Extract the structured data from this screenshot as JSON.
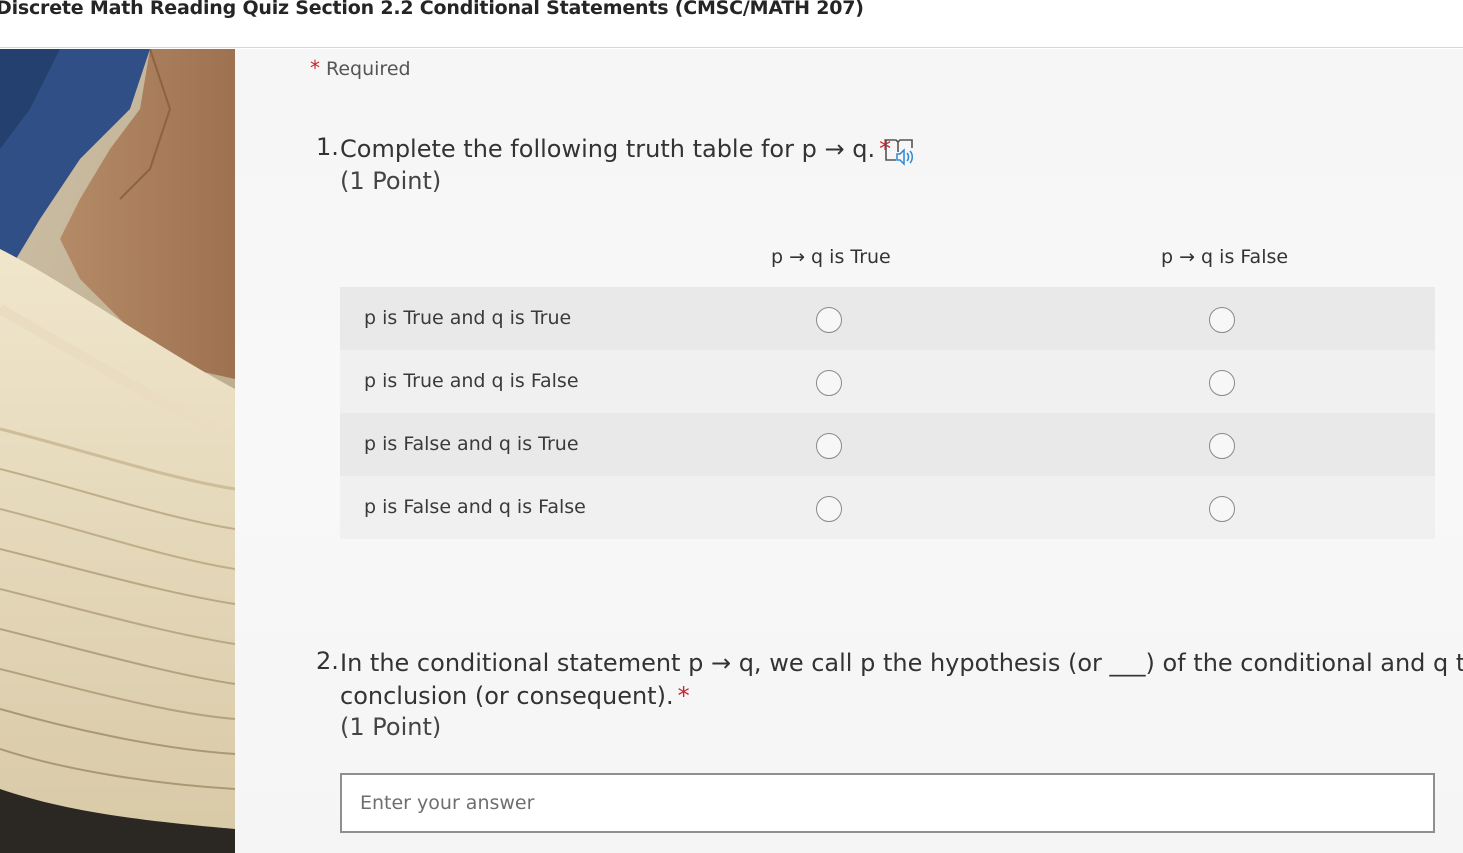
{
  "header": {
    "title": "Discrete Math Reading Quiz Section 2.2 Conditional Statements (CMSC/MATH 207)"
  },
  "form": {
    "required_star": "*",
    "required_label": "Required"
  },
  "questions": [
    {
      "number": "1.",
      "text": "Complete the following truth table for p → q.",
      "required_star": "*",
      "points": "(1 Point)",
      "icon": "immersive-reader-icon",
      "columns": [
        "p → q is True",
        "p → q is False"
      ],
      "rows": [
        "p is True and q is True",
        "p is True and q is False",
        "p is False and q is True",
        "p is False and q is False"
      ]
    },
    {
      "number": "2.",
      "text_line1": "In the conditional statement p → q, we call p the hypothesis (or ___) of the conditional and q the",
      "text_line2": "conclusion (or consequent).",
      "required_star": "*",
      "points": "(1 Point)",
      "placeholder": "Enter your answer"
    }
  ],
  "colors": {
    "required_star": "#c4262e",
    "background": "#f6f6f6",
    "row_shade": "#e9e9e9"
  }
}
